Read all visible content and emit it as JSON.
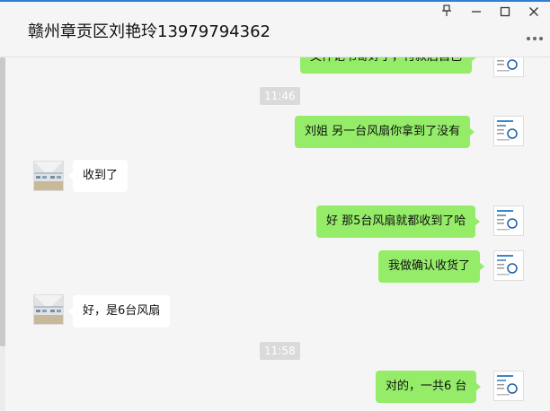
{
  "window": {
    "title": "赣州章贡区刘艳玲13979794362",
    "controls": {
      "pin_icon": "pin-icon",
      "minimize_icon": "minimize-icon",
      "maximize_icon": "maximize-icon",
      "close_icon": "close-icon",
      "more_icon": "more-icon"
    }
  },
  "colors": {
    "accent": "#2f7fd4",
    "my_bubble": "#95ec69",
    "other_bubble": "#ffffff",
    "background": "#f5f5f5",
    "timestamp_bg": "#dadada"
  },
  "chat": {
    "partial_top_message": "文件记书寄好了，付款后自己",
    "messages": [
      {
        "type": "timestamp",
        "text": "11:46"
      },
      {
        "type": "sent",
        "text": "刘姐  另一台风扇你拿到了没有"
      },
      {
        "type": "received",
        "text": "收到了"
      },
      {
        "type": "sent",
        "text": "好  那5台风扇就都收到了哈"
      },
      {
        "type": "sent",
        "text": "我做确认收货了"
      },
      {
        "type": "received",
        "text": "好，是6台风扇"
      },
      {
        "type": "timestamp",
        "text": "11:58"
      },
      {
        "type": "sent",
        "text": "对的，一共6  台"
      }
    ]
  }
}
